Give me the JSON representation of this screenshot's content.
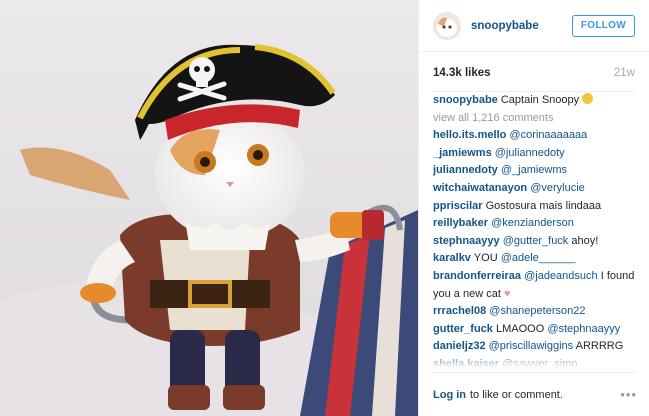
{
  "post": {
    "username": "snoopybabe",
    "follow_label": "FOLLOW",
    "likes": "14.3k likes",
    "age": "21w"
  },
  "caption": {
    "user": "snoopybabe",
    "text": "Captain Snoopy"
  },
  "view_all": "view all 1,216 comments",
  "comments": [
    {
      "user": "hello.its.mello",
      "mention": "@corinaaaaaaa",
      "text": ""
    },
    {
      "user": "_jamiewms",
      "mention": "@juliannedoty",
      "text": ""
    },
    {
      "user": "juliannedoty",
      "mention": "@_jamiewms",
      "text": ""
    },
    {
      "user": "witchaiwatanayon",
      "mention": "@verylucie",
      "text": ""
    },
    {
      "user": "ppriscilar",
      "mention": "",
      "text": "Gostosura mais lindaaa"
    },
    {
      "user": "reillybaker",
      "mention": "@kenzianderson",
      "text": ""
    },
    {
      "user": "stephnaayyy",
      "mention": "@gutter_fuck",
      "text": " ahoy!"
    },
    {
      "user": "karalkv",
      "mention": "@adele______",
      "text": "YOU "
    },
    {
      "user": "brandonferreiraa",
      "mention": "@jadeandsuch",
      "text": " I found you a new cat "
    },
    {
      "user": "rrrachel08",
      "mention": "@shanepeterson22",
      "text": ""
    },
    {
      "user": "gutter_fuck",
      "mention": "@stephnaayyy",
      "text": "LMAOOO "
    },
    {
      "user": "danieljz32",
      "mention": "@priscillawiggins",
      "text": " ARRRRG"
    },
    {
      "user": "shella.kaiser",
      "mention": "@sawyer_simo",
      "text": ""
    }
  ],
  "footer": {
    "login": "Log in",
    "rest": "to like or comment.",
    "more": "•••"
  },
  "colors": {
    "link": "#125688",
    "follow": "#3897f0",
    "muted": "#a5a7aa"
  }
}
